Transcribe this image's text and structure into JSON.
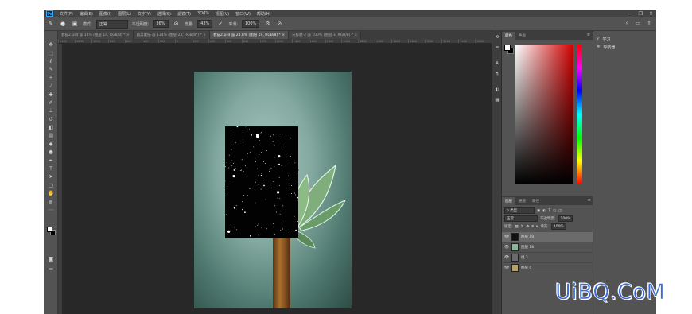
{
  "app": {
    "logo": "Ps",
    "menu": [
      "文件(F)",
      "编辑(E)",
      "图像(I)",
      "图层(L)",
      "文字(Y)",
      "选择(S)",
      "滤镜(T)",
      "3D(D)",
      "视图(V)",
      "窗口(W)",
      "帮助(H)"
    ],
    "window_controls": [
      "—",
      "❐",
      "✕"
    ]
  },
  "options_bar": {
    "mode_label": "模式:",
    "mode_value": "正常",
    "opacity_label": "不透明度:",
    "opacity_value": "36%",
    "flow_label": "流量:",
    "flow_value": "43%",
    "smoothing_label": "平滑:",
    "smoothing_value": "100%"
  },
  "document_tabs": [
    {
      "label": "春猫2.psd @ 14% (图层 14, RGB/8) * ×",
      "active": false
    },
    {
      "label": "蔬菜素描 @ 134% (图层 23, RGB/8*) * ×",
      "active": false
    },
    {
      "label": "春猫2.psd @ 24.8% (图层 19, RGB/8) * ×",
      "active": true
    },
    {
      "label": "未标题-2 @ 100% (图层 3, RGB/8) * ×",
      "active": false
    }
  ],
  "ruler_ticks": [
    "1400",
    "1200",
    "1000",
    "800",
    "600",
    "400",
    "200",
    "0",
    "200",
    "400",
    "600",
    "800",
    "1000",
    "1200",
    "1400",
    "1600",
    "1800",
    "2000",
    "2200",
    "2400",
    "2600",
    "2800",
    "3000",
    "3200",
    "3400",
    "3600"
  ],
  "color_panel": {
    "tabs": [
      "颜色",
      "色板"
    ],
    "menu": "≡"
  },
  "layers_panel": {
    "tabs": [
      "图层",
      "通道",
      "路径"
    ],
    "kind_label": "ρ 类型",
    "blend_mode": "正常",
    "opacity_label": "不透明度:",
    "opacity_value": "100%",
    "lock_label": "锁定:",
    "fill_label": "填充:",
    "fill_value": "100%",
    "layers": [
      {
        "name": "图层 19",
        "selected": true,
        "thumb_color": "#111111"
      },
      {
        "name": "图层 18",
        "selected": false,
        "thumb_color": "#8fb39a"
      },
      {
        "name": "组 2",
        "selected": false,
        "thumb_color": "#6b6b6b"
      },
      {
        "name": "图层 0",
        "selected": false,
        "thumb_color": "#b8a06a"
      }
    ]
  },
  "right_panel": {
    "items": [
      {
        "icon": "lightbulb-icon",
        "label": "学习"
      },
      {
        "icon": "navigator-icon",
        "label": "导航器"
      }
    ]
  },
  "watermark": {
    "text": "UiBQ.CoM"
  }
}
